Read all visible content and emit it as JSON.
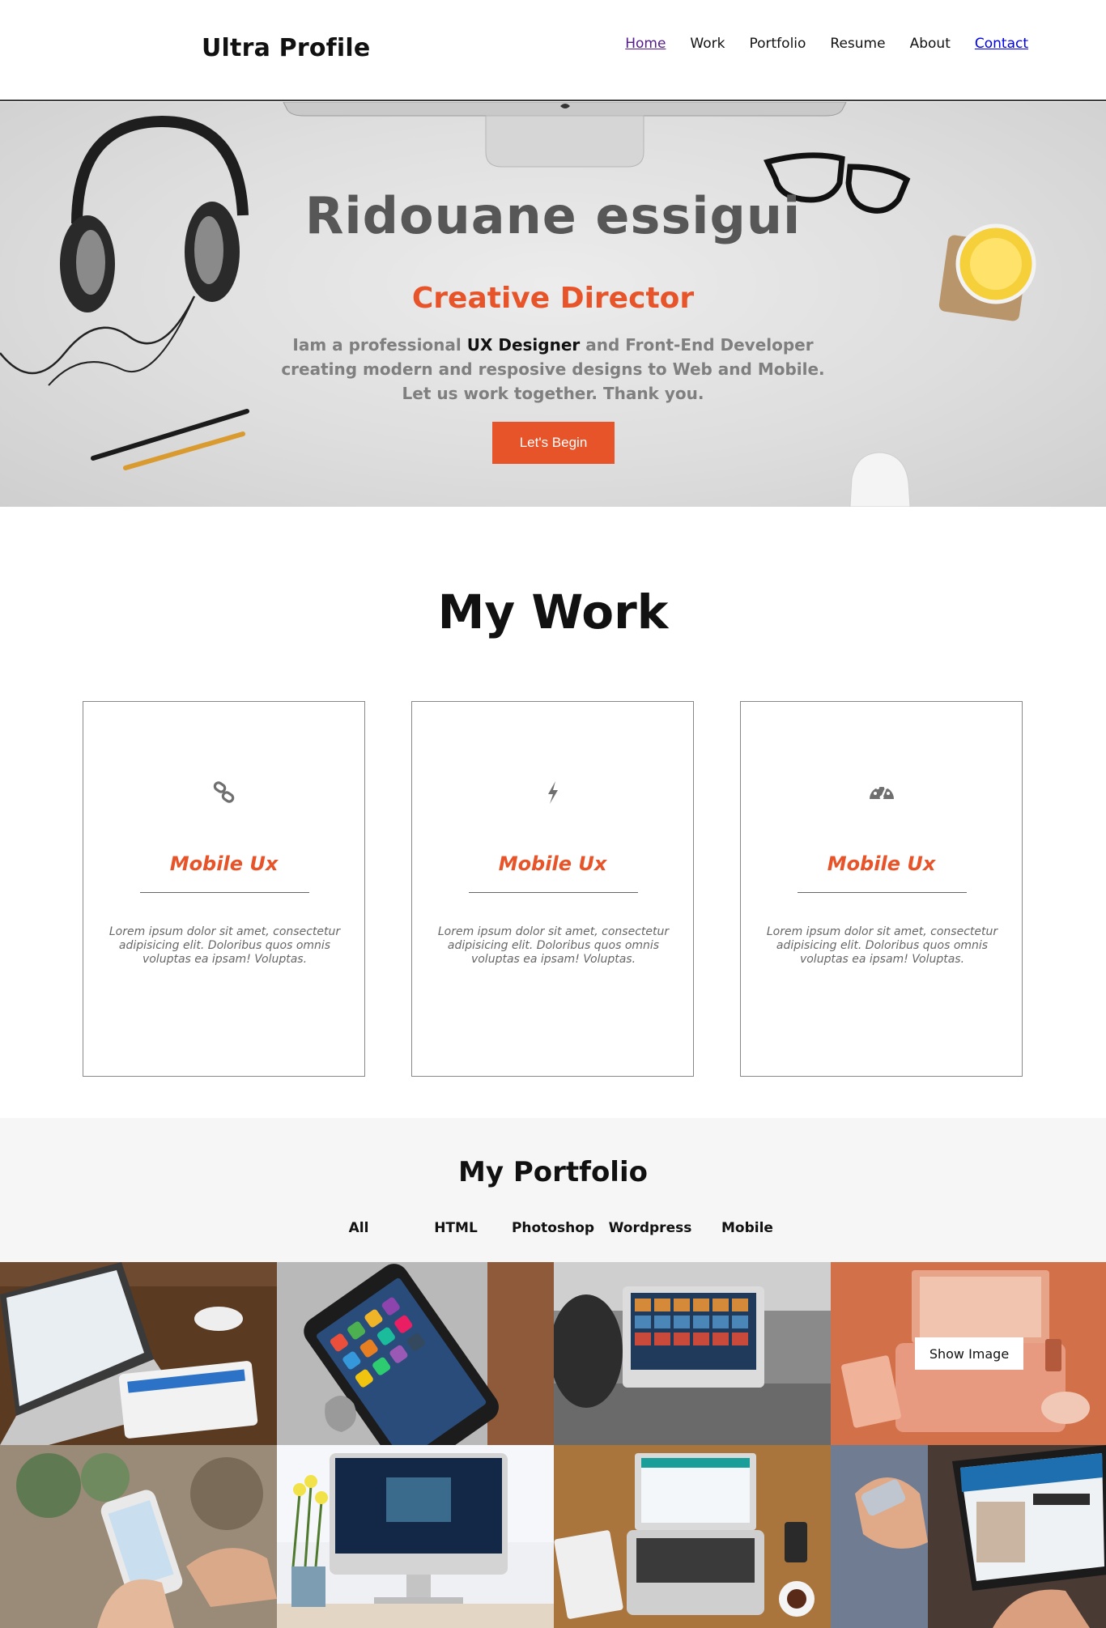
{
  "header": {
    "logo": "Ultra Profile",
    "nav": [
      "Home",
      "Work",
      "Portfolio",
      "Resume",
      "About",
      "Contact"
    ]
  },
  "hero": {
    "name": "Ridouane essigui",
    "role": "Creative Director",
    "intro_prefix": "Iam a professional ",
    "intro_strong": "UX Designer",
    "intro_suffix": " and Front-End Developer creating modern and resposive designs to Web and Mobile. Let us work together. Thank you.",
    "cta": "Let's Begin"
  },
  "work": {
    "title": "My Work",
    "cards": [
      {
        "icon": "link-icon",
        "title": "Mobile Ux",
        "text": "Lorem ipsum dolor sit amet, consectetur adipisicing elit. Doloribus quos omnis voluptas ea ipsam! Voluptas."
      },
      {
        "icon": "bolt-icon",
        "title": "Mobile Ux",
        "text": "Lorem ipsum dolor sit amet, consectetur adipisicing elit. Doloribus quos omnis voluptas ea ipsam! Voluptas."
      },
      {
        "icon": "dashboard-icon",
        "title": "Mobile Ux",
        "text": "Lorem ipsum dolor sit amet, consectetur adipisicing elit. Doloribus quos omnis voluptas ea ipsam! Voluptas."
      }
    ]
  },
  "portfolio": {
    "title": "My Portfolio",
    "filters": [
      "All",
      "HTML",
      "Photoshop",
      "Wordpress",
      "Mobile"
    ],
    "hover_button": "Show Image"
  },
  "colors": {
    "accent": "#e8542a",
    "hero_text": "#575757",
    "muted": "#7f7f7f",
    "portfolio_bg": "#f6f6f6"
  }
}
